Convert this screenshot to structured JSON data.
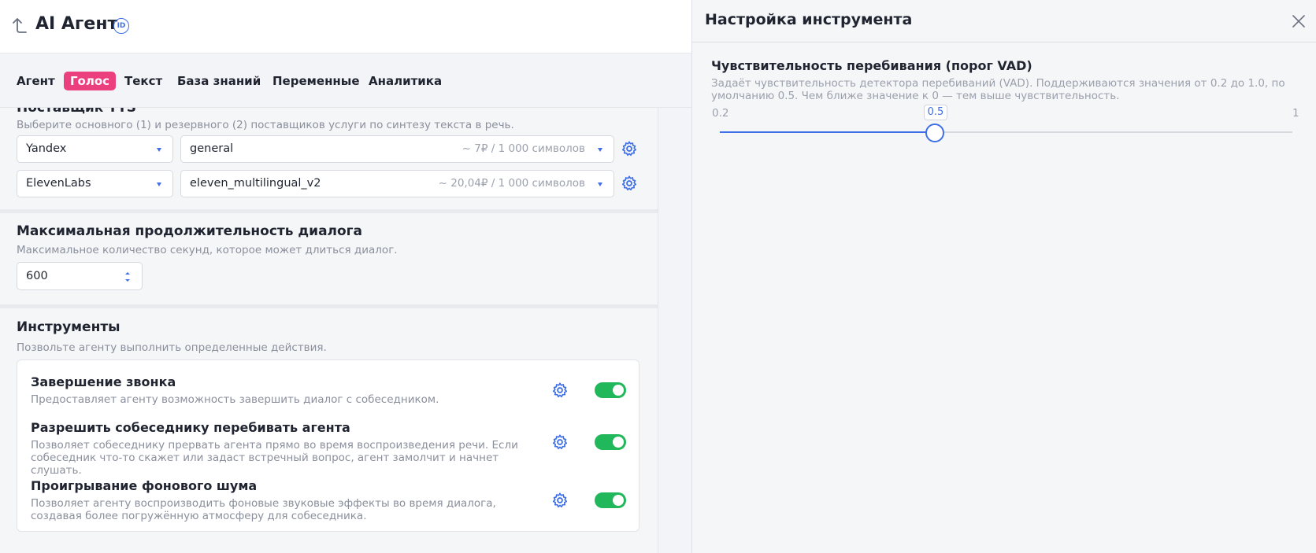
{
  "header": {
    "title": "AI Агент",
    "id_badge": "ID"
  },
  "tabs": [
    {
      "label": "Агент",
      "active": false
    },
    {
      "label": "Голос",
      "active": true
    },
    {
      "label": "Текст",
      "active": false
    },
    {
      "label": "База знаний",
      "active": false
    },
    {
      "label": "Переменные",
      "active": false
    },
    {
      "label": "Аналитика",
      "active": false
    }
  ],
  "tts": {
    "title": "Поставщик TTS",
    "description": "Выберите основного (1) и резервного (2) поставщиков услуги по синтезу текста в речь.",
    "rows": [
      {
        "provider": "Yandex",
        "model": "general",
        "price": "~ 7₽ / 1 000 символов"
      },
      {
        "provider": "ElevenLabs",
        "model": "eleven_multilingual_v2",
        "price": "~ 20,04₽ / 1 000 символов"
      }
    ]
  },
  "duration": {
    "title": "Максимальная продолжительность диалога",
    "description": "Максимальное количество секунд, которое может длиться диалог.",
    "value": "600"
  },
  "tools": {
    "title": "Инструменты",
    "description": "Позвольте агенту выполнить определенные действия.",
    "items": [
      {
        "title": "Завершение звонка",
        "description": "Предоставляет агенту возможность завершить диалог с собеседником.",
        "enabled": true
      },
      {
        "title": "Разрешить собеседнику перебивать агента",
        "description": "Позволяет собеседнику прервать агента прямо во время воспроизведения речи. Если собеседник что-то скажет или задаст встречный вопрос, агент замолчит и начнет слушать.",
        "enabled": true
      },
      {
        "title": "Проигрывание фонового шума",
        "description": "Позволяет агенту воспроизводить фоновые звуковые эффекты во время диалога, создавая более погружённую атмосферу для собеседника.",
        "enabled": true
      }
    ]
  },
  "panel": {
    "title": "Настройка инструмента",
    "param_title": "Чувствительность перебивания (порог VAD)",
    "param_description": "Задаёт чувствительность детектора перебиваний (VAD). Поддерживаются значения от 0.2 до 1.0, по умолчанию 0.5. Чем ближе значение к 0 — тем выше чувствительность.",
    "slider": {
      "min": 0.2,
      "max": 1,
      "value": 0.5,
      "min_label": "0.2",
      "max_label": "1",
      "value_label": "0.5"
    }
  },
  "colors": {
    "accent": "#3f6fe6",
    "active_tab": "#ec3f7e",
    "toggle_on": "#20b85a"
  },
  "icons": [
    "back-arrow-icon",
    "id-icon",
    "chevron-down-icon",
    "gear-icon",
    "spinner-arrows-icon",
    "close-icon"
  ]
}
